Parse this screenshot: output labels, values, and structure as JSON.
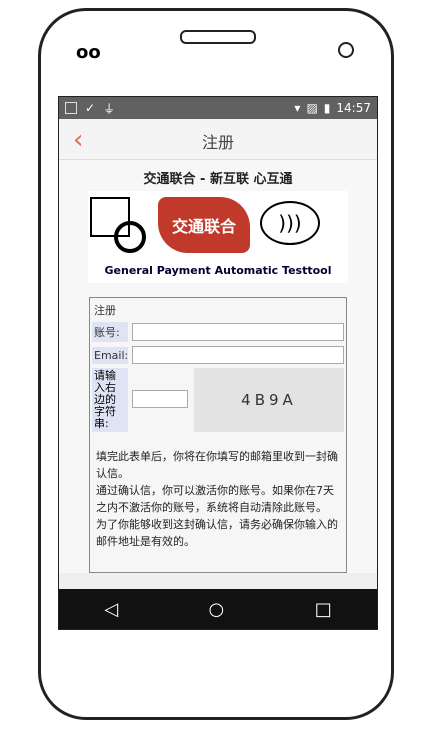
{
  "status": {
    "time": "14:57"
  },
  "header": {
    "title": "注册",
    "back_icon": "back-icon"
  },
  "banner": {
    "slogan": "交通联合 - 新互联 心互通",
    "logo_text": "交通联合",
    "gpat": "General Payment Automatic Testtool"
  },
  "form": {
    "legend": "注册",
    "account_label": "账号:",
    "email_label": "Email:",
    "captcha_label": "请输入右边的字符串:",
    "captcha_text": "4B9A"
  },
  "note": {
    "p1": "填完此表单后，你将在你填写的邮箱里收到一封确认信。",
    "p2": "通过确认信，你可以激活你的账号。如果你在7天之内不激活你的账号，系统将自动清除此账号。",
    "p3": "为了你能够收到这封确认信，请务必确保你输入的邮件地址是有效的。"
  }
}
